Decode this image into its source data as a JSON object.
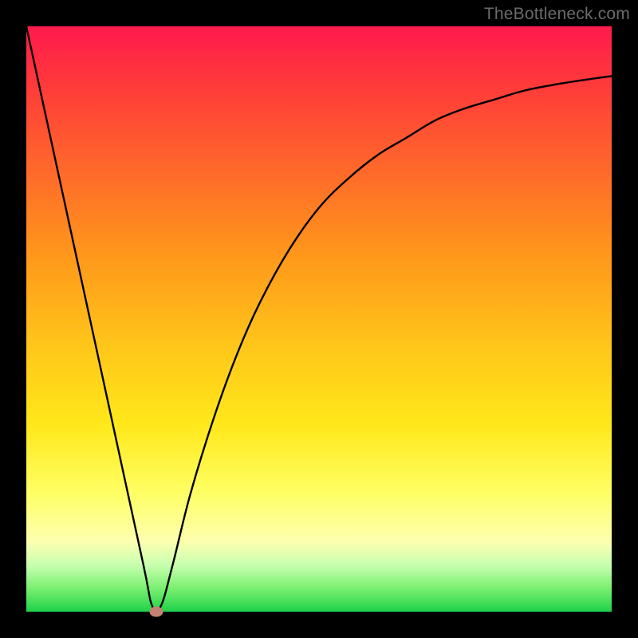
{
  "watermark": "TheBottleneck.com",
  "marker": {
    "x_pct": 22.2,
    "y_pct": 100
  },
  "colors": {
    "marker": "#c58274",
    "curve": "#000000",
    "frame": "#000000"
  },
  "chart_data": {
    "type": "line",
    "title": "",
    "xlabel": "",
    "ylabel": "",
    "xlim": [
      0,
      100
    ],
    "ylim": [
      0,
      100
    ],
    "series": [
      {
        "name": "bottleneck-curve",
        "x": [
          0,
          5,
          10,
          15,
          20,
          21.5,
          23,
          25,
          28,
          32,
          36,
          40,
          45,
          50,
          55,
          60,
          65,
          70,
          75,
          80,
          85,
          90,
          95,
          100
        ],
        "y": [
          100,
          77,
          54,
          31,
          8,
          1,
          1,
          8,
          20,
          33,
          44,
          53,
          62,
          69,
          74,
          78,
          81,
          84,
          86,
          87.5,
          89,
          90,
          90.8,
          91.5
        ]
      }
    ],
    "background_gradient": [
      {
        "stop": 0,
        "color": "#ff1a4d"
      },
      {
        "stop": 25,
        "color": "#ff6a2a"
      },
      {
        "stop": 55,
        "color": "#ffc71a"
      },
      {
        "stop": 80,
        "color": "#ffff66"
      },
      {
        "stop": 100,
        "color": "#1fd24a"
      }
    ],
    "annotations": []
  }
}
